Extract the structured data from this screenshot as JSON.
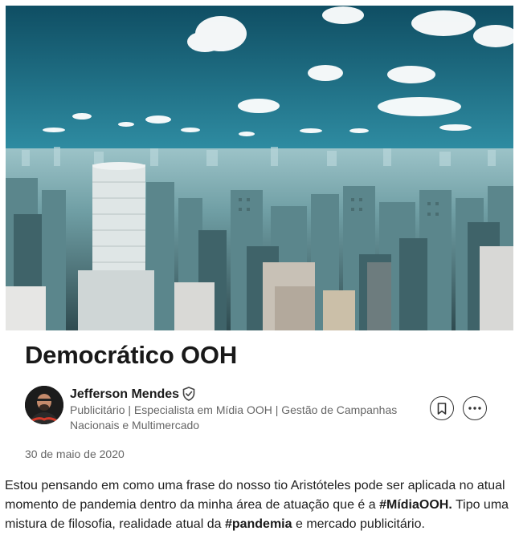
{
  "article": {
    "title": "Democrático OOH",
    "hero_image": "São Paulo city skyline aerial photo",
    "date": "30 de maio de 2020"
  },
  "author": {
    "name": "Jefferson Mendes",
    "headline": "Publicitário | Especialista em Mídia OOH | Gestão de Campanhas Nacionais e Multimercado",
    "verified_icon": "shield-check-icon",
    "avatar_icon": "avatar"
  },
  "actions": {
    "save_icon": "bookmark-icon",
    "more_icon": "ellipsis-icon"
  },
  "body": {
    "p1_part1": "Estou pensando em como uma frase do nosso tio Aristóteles pode ser aplicada no atual momento de pandemia dentro da minha área de atuação que é a ",
    "hashtag1": "#MídiaOOH.",
    "p1_part2": " Tipo uma mistura de filosofia, realidade atual da ",
    "hashtag2": "#pandemia",
    "p1_part3": " e mercado publicitário."
  },
  "colors": {
    "sky_top": "#12546a",
    "sky_bottom": "#bfe3ec",
    "city": "#5f8f96",
    "text": "#1f1f1f",
    "muted": "#666666"
  }
}
